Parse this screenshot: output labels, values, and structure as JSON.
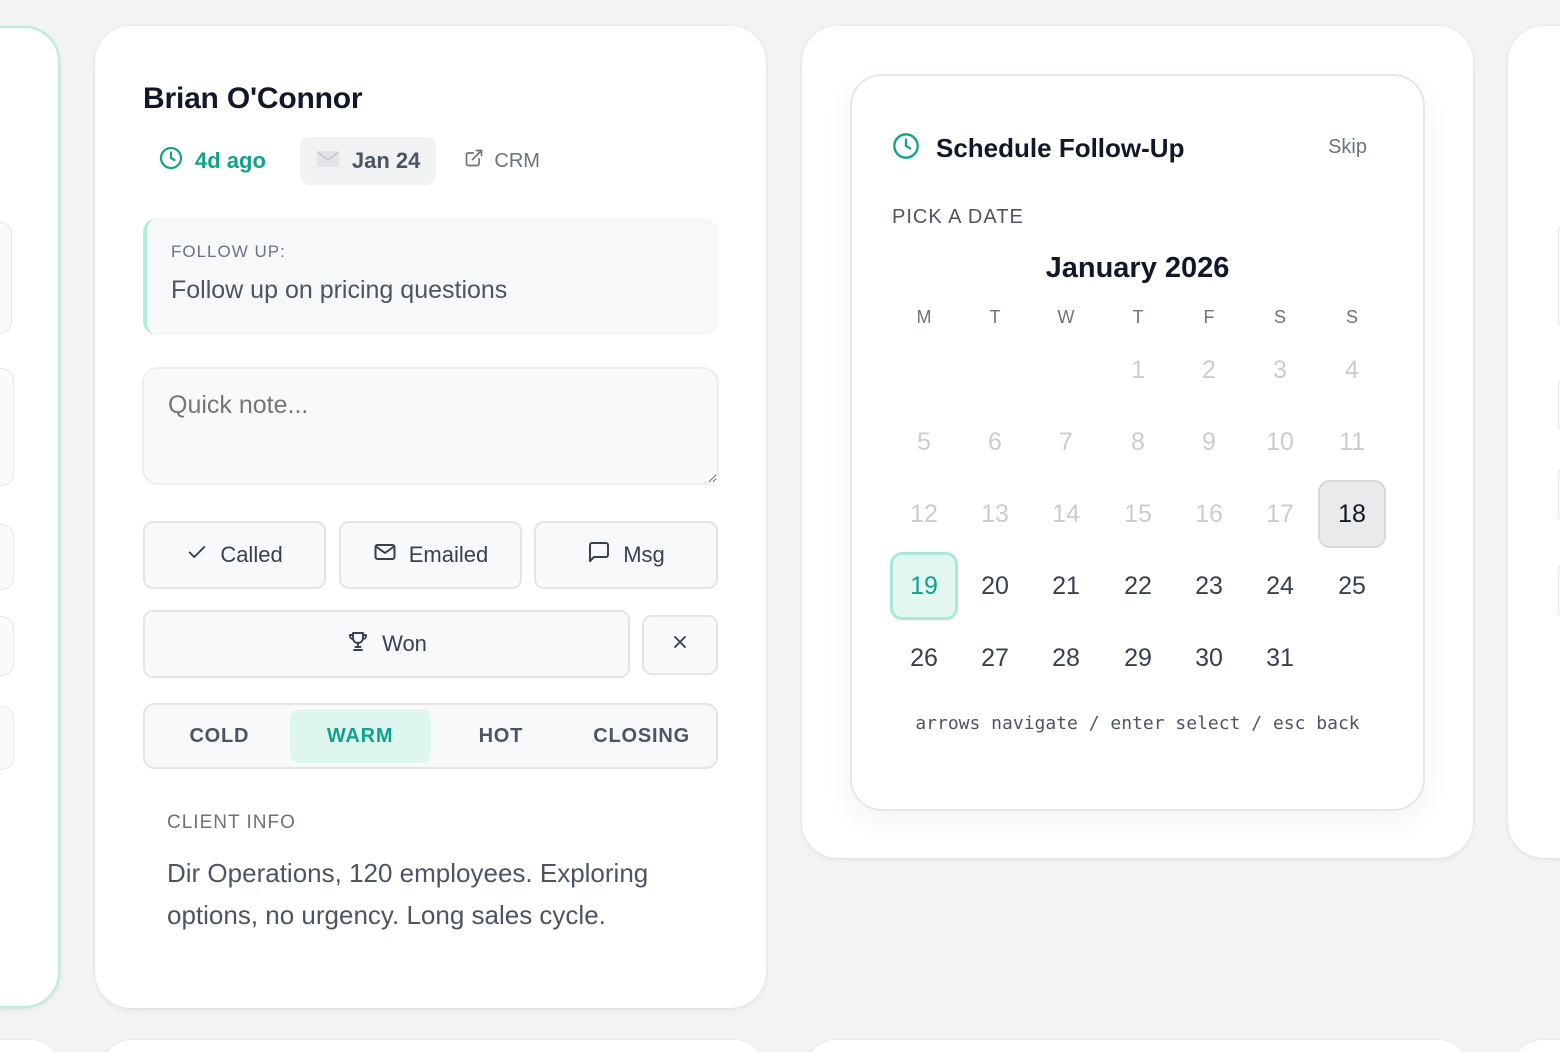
{
  "lead": {
    "name": "Brian O'Connor",
    "age": "4d ago",
    "last_email_date": "Jan 24",
    "crm_label": "CRM",
    "follow_up_label": "FOLLOW UP:",
    "follow_up_text": "Follow up on pricing questions",
    "note_placeholder": "Quick note...",
    "actions": {
      "called": "Called",
      "emailed": "Emailed",
      "msg": "Msg",
      "won": "Won"
    },
    "temperature": {
      "options": [
        "COLD",
        "WARM",
        "HOT",
        "CLOSING"
      ],
      "selected": "WARM"
    },
    "client_info_label": "CLIENT INFO",
    "client_info_text": "Dir Operations, 120 employees. Exploring options, no urgency. Long sales cycle."
  },
  "scheduler": {
    "title": "Schedule Follow-Up",
    "skip_label": "Skip",
    "pick_label": "PICK A DATE",
    "month_label": "January 2026",
    "weekdays": [
      "M",
      "T",
      "W",
      "T",
      "F",
      "S",
      "S"
    ],
    "weeks": [
      [
        "",
        "",
        "",
        "1",
        "2",
        "3",
        "4"
      ],
      [
        "5",
        "6",
        "7",
        "8",
        "9",
        "10",
        "11"
      ],
      [
        "12",
        "13",
        "14",
        "15",
        "16",
        "17",
        "18"
      ],
      [
        "19",
        "20",
        "21",
        "22",
        "23",
        "24",
        "25"
      ],
      [
        "26",
        "27",
        "28",
        "29",
        "30",
        "31",
        ""
      ]
    ],
    "disabled_before": 18,
    "highlighted_day": "18",
    "today": "19",
    "hint": "arrows navigate / enter select / esc back"
  },
  "colors": {
    "accent": "#10a38a",
    "accent_light": "#def6f0",
    "accent_border": "#a8e8d9"
  }
}
